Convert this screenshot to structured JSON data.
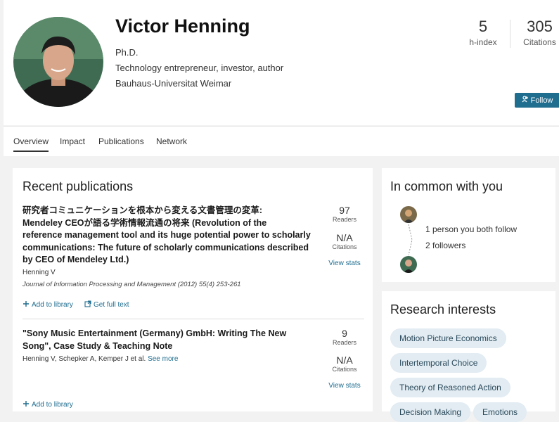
{
  "profile": {
    "name": "Victor Henning",
    "degree": "Ph.D.",
    "tagline": "Technology entrepreneur, investor, author",
    "institution": "Bauhaus-Universitat Weimar"
  },
  "stats": {
    "h_index_value": "5",
    "h_index_label": "h-index",
    "citations_value": "305",
    "citations_label": "Citations"
  },
  "follow_label": "Follow",
  "tabs": [
    {
      "label": "Overview"
    },
    {
      "label": "Impact"
    },
    {
      "label": "Publications"
    },
    {
      "label": "Network"
    }
  ],
  "recent": {
    "title": "Recent publications",
    "items": [
      {
        "title_lines": [
          "研究者コミュニケーションを根本から変える文書管理の変革:",
          "Mendeley CEOが語る学術情報流通の将来 (Revolution of the",
          "reference management tool and its huge potential power to scholarly",
          "communications: The future of scholarly communications described",
          "by CEO of Mendeley Ltd.)"
        ],
        "authors": "Henning V",
        "journal": "Journal of Information Processing and Management (2012) 55(4) 253-261",
        "readers": "97",
        "readers_label": "Readers",
        "citations": "N/A",
        "citations_label": "Citations",
        "view_stats": "View stats",
        "add_label": "Add to library",
        "fulltext_label": "Get full text"
      },
      {
        "title_lines": [
          "\"Sony Music Entertainment (Germany) GmbH: Writing The New",
          "Song\", Case Study & Teaching Note"
        ],
        "authors": "Henning V, Schepker A, Kemper J et al.",
        "see_more": "See more",
        "readers": "9",
        "readers_label": "Readers",
        "citations": "N/A",
        "citations_label": "Citations",
        "view_stats": "View stats",
        "add_label": "Add to library"
      }
    ]
  },
  "common": {
    "title": "In common with you",
    "follow_text": "1 person you both follow",
    "followers_text": "2 followers"
  },
  "interests": {
    "title": "Research interests",
    "chips": [
      "Motion Picture Economics",
      "Intertemporal Choice",
      "Theory of Reasoned Action",
      "Decision Making",
      "Emotions"
    ]
  },
  "colors": {
    "accent": "#1f6d8f",
    "chip_bg": "#e2ecf2"
  }
}
